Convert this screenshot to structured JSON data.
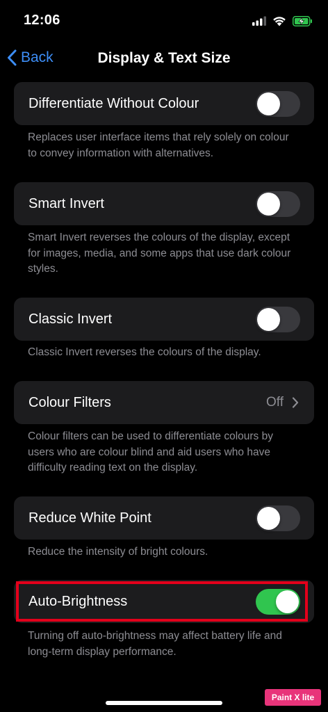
{
  "status_bar": {
    "time": "12:06",
    "icons": [
      "cellular-signal-icon",
      "wifi-icon",
      "battery-charging-icon"
    ]
  },
  "nav": {
    "back_label": "Back",
    "title": "Display & Text Size"
  },
  "settings": [
    {
      "label": "Differentiate Without Colour",
      "toggle_on": false,
      "footer": "Replaces user interface items that rely solely on colour to convey information with alternatives."
    },
    {
      "label": "Smart Invert",
      "toggle_on": false,
      "footer": "Smart Invert reverses the colours of the display, except for images, media, and some apps that use dark colour styles."
    },
    {
      "label": "Classic Invert",
      "toggle_on": false,
      "footer": "Classic Invert reverses the colours of the display."
    },
    {
      "label": "Colour Filters",
      "value": "Off",
      "footer": "Colour filters can be used to differentiate colours by users who are colour blind and aid users who have difficulty reading text on the display."
    },
    {
      "label": "Reduce White Point",
      "toggle_on": false,
      "footer": "Reduce the intensity of bright colours."
    },
    {
      "label": "Auto-Brightness",
      "toggle_on": true,
      "footer": "Turning off auto-brightness may affect battery life and long-term display performance."
    }
  ],
  "watermark": "Paint X lite",
  "colors": {
    "accent": "#3d8ef7",
    "toggle_on": "#30c54f",
    "toggle_off": "#39393d",
    "cell_bg": "#1c1c1e",
    "secondary_text": "#8d8d93",
    "highlight": "#e3001b"
  }
}
